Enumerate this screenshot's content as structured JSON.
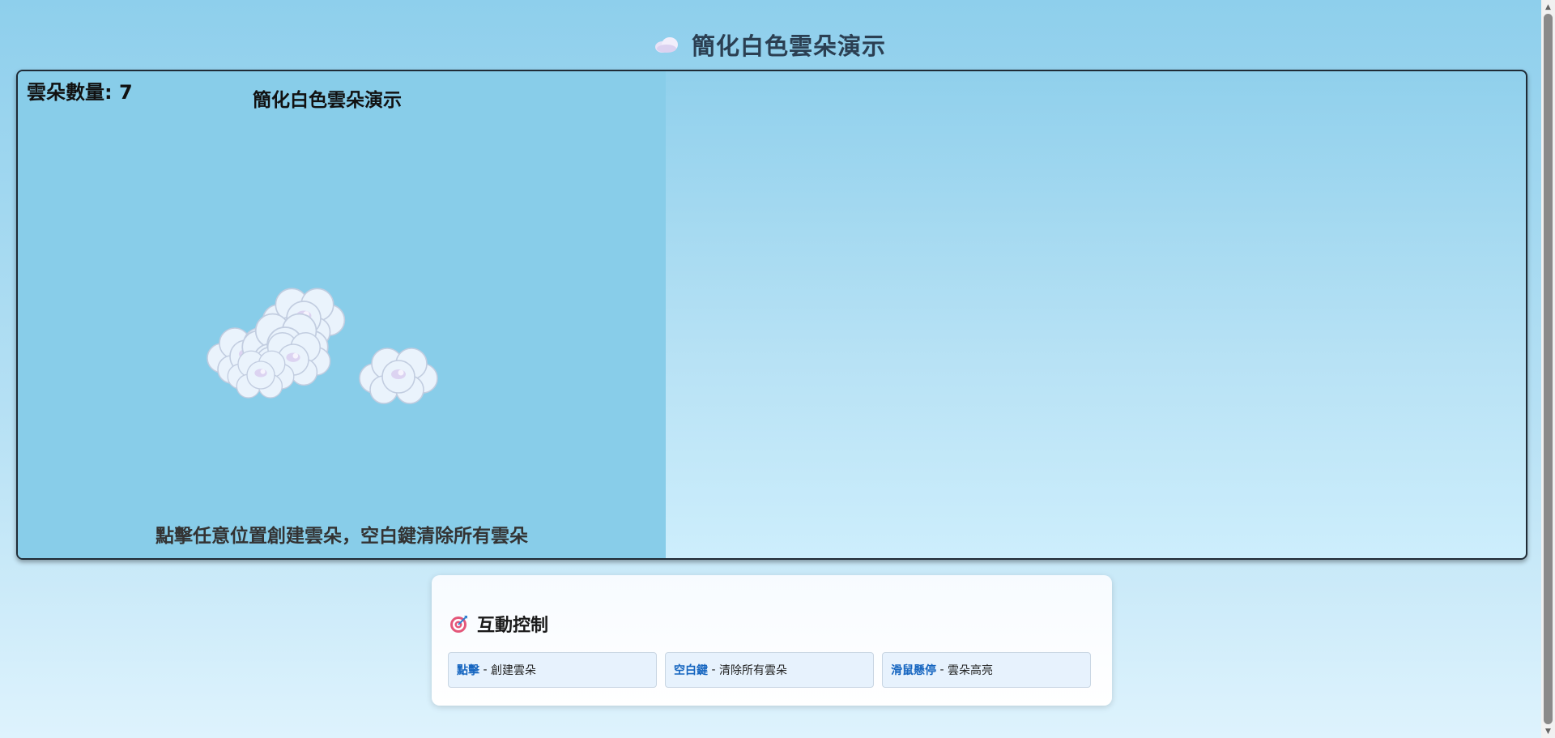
{
  "header": {
    "icon": "cloud-icon",
    "title": "簡化白色雲朵演示"
  },
  "canvas": {
    "count_label": "雲朵數量: 7",
    "title": "簡化白色雲朵演示",
    "instruction": "點擊任意位置創建雲朵，空白鍵清除所有雲朵",
    "cloud_count": 7
  },
  "controls": {
    "icon": "target-icon",
    "title": "互動控制",
    "items": [
      {
        "key": "點擊",
        "separator": " - ",
        "description": "創建雲朵"
      },
      {
        "key": "空白鍵",
        "separator": " - ",
        "description": "清除所有雲朵"
      },
      {
        "key": "滑鼠懸停",
        "separator": " - ",
        "description": "雲朵高亮"
      }
    ]
  },
  "colors": {
    "canvas_background": "#88cde9",
    "cloud_fill": "#eaf3fc",
    "cloud_stroke": "#c2cde0",
    "accent_key": "#1565c0"
  }
}
